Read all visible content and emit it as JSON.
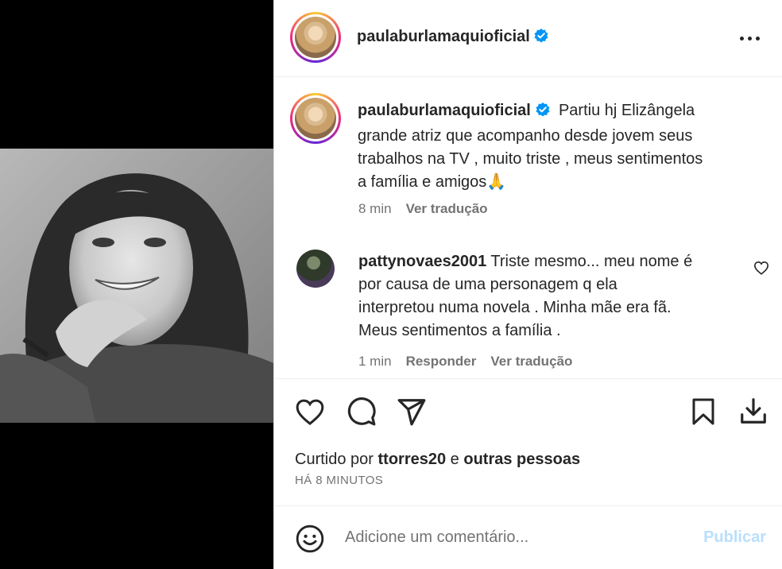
{
  "post": {
    "username": "paulaburlamaquioficial",
    "caption_lines": [
      "Partiu hj Elizângela",
      "grande atriz que acompanho desde jovem seus",
      "trabalhos na TV , muito triste , meus sentimentos",
      "a família e amigos🙏"
    ],
    "caption_time": "8 min",
    "translate_label": "Ver tradução"
  },
  "comment": {
    "username": "pattynovaes2001",
    "lines": [
      "Triste mesmo... meu nome é",
      "por causa de uma personagem q ela",
      "interpretou numa novela . Minha mãe era fã.",
      "Meus sentimentos a família ."
    ],
    "time": "1 min",
    "reply_label": "Responder",
    "translate_label": "Ver tradução"
  },
  "likes": {
    "prefix": "Curtido por",
    "user": "ttorres20",
    "joiner": "e",
    "others": "outras pessoas",
    "time_ago": "HÁ 8 MINUTOS"
  },
  "composer": {
    "placeholder": "Adicione um comentário...",
    "publish_label": "Publicar"
  },
  "colors": {
    "verified": "#0095f6",
    "publish_disabled": "#b9dffc"
  },
  "icons": [
    "verified-badge-icon",
    "more-options-icon",
    "heart-icon",
    "comment-icon",
    "share-icon",
    "bookmark-icon",
    "download-icon",
    "emoji-icon"
  ]
}
